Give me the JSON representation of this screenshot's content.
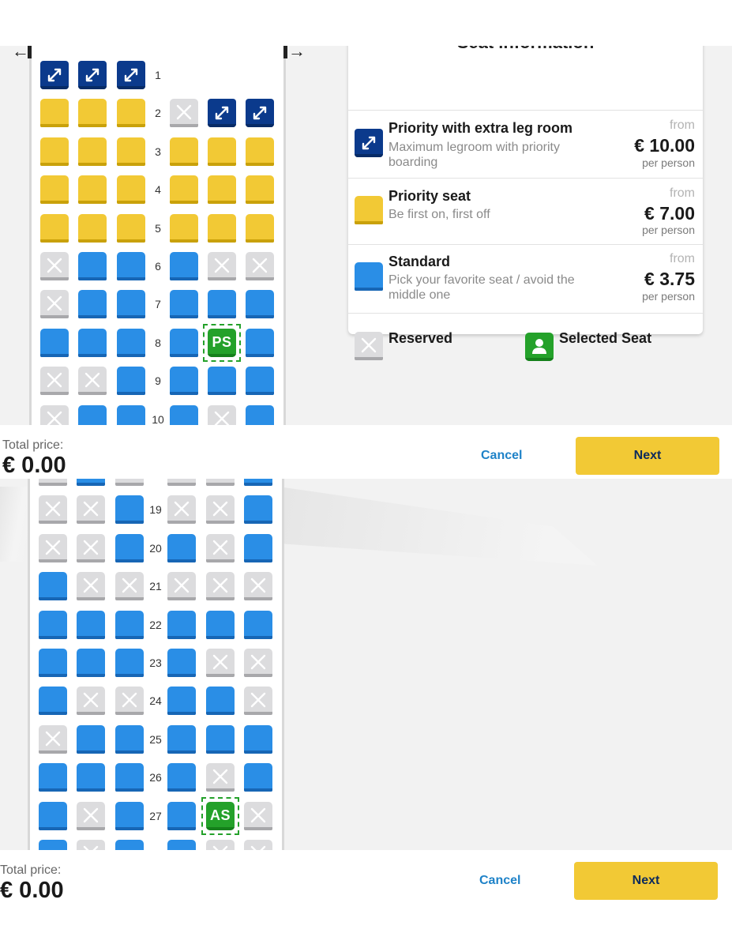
{
  "screens": [
    {
      "rows": [
        {
          "num": "1",
          "seats": [
            "extra",
            "extra",
            "extra",
            null,
            null,
            null
          ]
        },
        {
          "num": "2",
          "seats": [
            "priority",
            "priority",
            "priority",
            "reserved",
            "extra",
            "extra"
          ]
        },
        {
          "num": "3",
          "seats": [
            "priority",
            "priority",
            "priority",
            "priority",
            "priority",
            "priority"
          ]
        },
        {
          "num": "4",
          "seats": [
            "priority",
            "priority",
            "priority",
            "priority",
            "priority",
            "priority"
          ]
        },
        {
          "num": "5",
          "seats": [
            "priority",
            "priority",
            "priority",
            "priority",
            "priority",
            "priority"
          ]
        },
        {
          "num": "6",
          "seats": [
            "reserved",
            "standard",
            "standard",
            "standard",
            "reserved",
            "reserved"
          ]
        },
        {
          "num": "7",
          "seats": [
            "reserved",
            "standard",
            "standard",
            "standard",
            "standard",
            "standard"
          ]
        },
        {
          "num": "8",
          "seats": [
            "standard",
            "standard",
            "standard",
            "standard",
            "selected:PS",
            "standard"
          ]
        },
        {
          "num": "9",
          "seats": [
            "reserved",
            "reserved",
            "standard",
            "standard",
            "standard",
            "standard"
          ]
        },
        {
          "num": "10",
          "seats": [
            "reserved",
            "standard",
            "standard",
            "standard",
            "reserved",
            "standard"
          ]
        }
      ],
      "total_label": "Total price:",
      "total_value": "€ 0.00",
      "cancel_label": "Cancel",
      "next_label": "Next"
    },
    {
      "rows": [
        {
          "num": "",
          "seats": [
            "reserved",
            "standard",
            "reserved",
            "reserved",
            "reserved",
            "standard"
          ]
        },
        {
          "num": "19",
          "seats": [
            "reserved",
            "reserved",
            "standard",
            "reserved",
            "reserved",
            "standard"
          ]
        },
        {
          "num": "20",
          "seats": [
            "reserved",
            "reserved",
            "standard",
            "standard",
            "reserved",
            "standard"
          ]
        },
        {
          "num": "21",
          "seats": [
            "standard",
            "reserved",
            "reserved",
            "reserved",
            "reserved",
            "reserved"
          ]
        },
        {
          "num": "22",
          "seats": [
            "standard",
            "standard",
            "standard",
            "standard",
            "standard",
            "standard"
          ]
        },
        {
          "num": "23",
          "seats": [
            "standard",
            "standard",
            "standard",
            "standard",
            "reserved",
            "reserved"
          ]
        },
        {
          "num": "24",
          "seats": [
            "standard",
            "reserved",
            "reserved",
            "standard",
            "standard",
            "reserved"
          ]
        },
        {
          "num": "25",
          "seats": [
            "reserved",
            "standard",
            "standard",
            "standard",
            "standard",
            "standard"
          ]
        },
        {
          "num": "26",
          "seats": [
            "standard",
            "standard",
            "standard",
            "standard",
            "reserved",
            "standard"
          ]
        },
        {
          "num": "27",
          "seats": [
            "standard",
            "reserved",
            "standard",
            "standard",
            "selected:AS",
            "reserved"
          ]
        },
        {
          "num": "",
          "seats": [
            "standard",
            "reserved",
            "standard",
            "standard",
            "reserved",
            "reserved"
          ]
        }
      ],
      "total_label": "Total price:",
      "total_value": "€ 0.00",
      "cancel_label": "Cancel",
      "next_label": "Next"
    }
  ],
  "seat_info": {
    "title": "Seat information",
    "types": [
      {
        "icon": "extra-legroom-seat-icon",
        "name": "Priority with extra leg room",
        "desc": "Maximum legroom with priority boarding",
        "from": "from",
        "price": "€ 10.00",
        "per": "per person"
      },
      {
        "icon": "priority-seat-icon",
        "name": "Priority seat",
        "desc": "Be first on, first off",
        "from": "from",
        "price": "€ 7.00",
        "per": "per person"
      },
      {
        "icon": "standard-seat-icon",
        "name": "Standard",
        "desc": "Pick your favorite seat / avoid the middle one",
        "from": "from",
        "price": "€ 3.75",
        "per": "per person"
      }
    ],
    "legend": {
      "reserved": "Reserved",
      "selected": "Selected Seat"
    }
  },
  "colors": {
    "priority": "#f2c935",
    "standard": "#2a8ee6",
    "extra_legroom": "#0b3a8c",
    "reserved": "#dcdcde",
    "selected": "#24a12a",
    "next_button": "#f2c935",
    "cancel_link": "#1e82c8"
  },
  "icons": {
    "exit_left": "exit-left-icon",
    "exit_right": "exit-right-icon",
    "reserved_mark": "cross-icon",
    "extra_legroom_mark": "diagonal-arrows-icon",
    "selected_legend": "person-icon"
  }
}
